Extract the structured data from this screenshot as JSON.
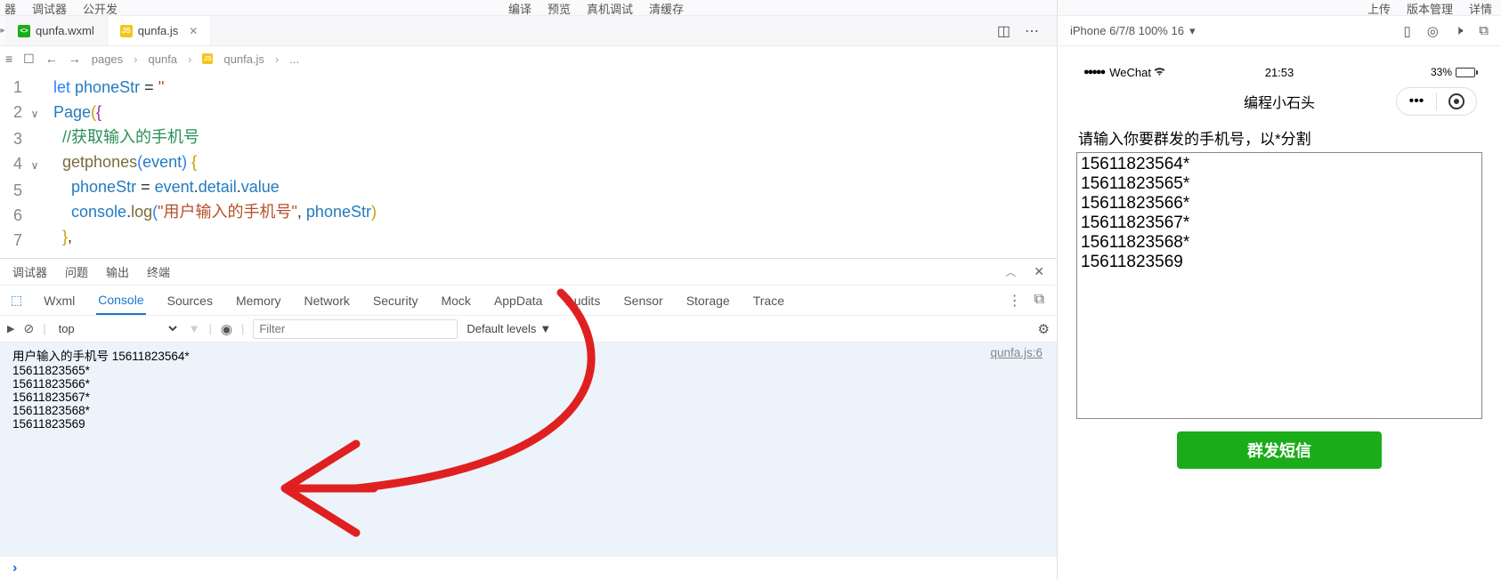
{
  "topbar_left": [
    "器",
    "调试器",
    "公开发"
  ],
  "topbar_center": [
    "编译",
    "预览",
    "真机调试",
    "清缓存"
  ],
  "topbar_right": [
    "上传",
    "版本管理",
    "详情"
  ],
  "tabs": [
    {
      "icon": "wxml",
      "label": "qunfa.wxml",
      "active": false
    },
    {
      "icon": "js",
      "label": "qunfa.js",
      "active": true
    }
  ],
  "breadcrumb": {
    "parts": [
      "pages",
      "qunfa",
      "qunfa.js",
      "..."
    ],
    "icon_before_last": "js"
  },
  "code": {
    "lines": [
      {
        "n": 1,
        "fold": "",
        "html": "<span class='kw'>let</span> <span class='ident'>phoneStr</span> <span class='punct'>=</span> <span class='str'>''</span>"
      },
      {
        "n": 2,
        "fold": "∨",
        "html": "<span class='ident'>Page</span><span class='yellow'>(</span><span class='purple'>{</span>"
      },
      {
        "n": 3,
        "fold": "",
        "html": "  <span class='comment'>//获取输入的手机号</span>"
      },
      {
        "n": 4,
        "fold": "∨",
        "html": "  <span class='method'>getphones</span><span class='kw'>(</span><span class='ident'>event</span><span class='kw'>)</span> <span class='yellow'>{</span>"
      },
      {
        "n": 5,
        "fold": "",
        "html": "    <span class='ident'>phoneStr</span> <span class='punct'>=</span> <span class='ident'>event</span><span class='punct'>.</span><span class='ident'>detail</span><span class='punct'>.</span><span class='ident'>value</span>"
      },
      {
        "n": 6,
        "fold": "",
        "html": "    <span class='ident'>console</span><span class='punct'>.</span><span class='method'>log</span><span class='kw'>(</span><span class='str'>\"用户输入的手机号\"</span><span class='punct'>,</span> <span class='ident'>phoneStr</span><span class='yellow'>)</span>"
      },
      {
        "n": 7,
        "fold": "",
        "html": "  <span class='yellow'>}</span><span class='punct'>,</span>"
      }
    ]
  },
  "debug": {
    "tabs1": [
      "调试器",
      "问题",
      "输出",
      "终端"
    ],
    "tabs2": [
      "Wxml",
      "Console",
      "Sources",
      "Memory",
      "Network",
      "Security",
      "Mock",
      "AppData",
      "Audits",
      "Sensor",
      "Storage",
      "Trace"
    ],
    "tabs2_active": "Console",
    "toolbar": {
      "context": "top",
      "filter_placeholder": "Filter",
      "levels": "Default levels"
    },
    "log": {
      "prefix": "用户输入的手机号",
      "body": "15611823564*\n15611823565*\n15611823566*\n15611823567*\n15611823568*\n15611823569",
      "source": "qunfa.js:6"
    }
  },
  "simulator": {
    "device": "iPhone 6/7/8 100% 16",
    "status": {
      "carrier": "WeChat",
      "time": "21:53",
      "battery": "33%"
    },
    "nav_title": "编程小石头",
    "page_label": "请输入你要群发的手机号，以*分割",
    "textarea": "15611823564*\n15611823565*\n15611823566*\n15611823567*\n15611823568*\n15611823569",
    "button": "群发短信"
  }
}
